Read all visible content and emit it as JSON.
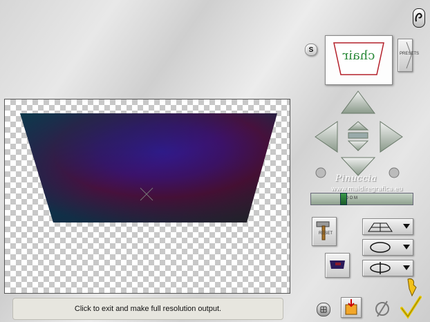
{
  "status_bar": {
    "text": "Click to exit and make full resolution output."
  },
  "toolbar": {
    "s_label": "S",
    "presets_label": "PRESETS",
    "reset_label": "RESET"
  },
  "preview_thumbnail": {
    "text": "chair"
  },
  "zoom_slider": {
    "label": "Z O O M",
    "value": 0.3
  },
  "watermark": {
    "line1": "Pinuccia",
    "line2": "www.maidiregrafica.eu"
  },
  "colors": {
    "accent": "#2b7a3a",
    "image_dark": "#0d3a4d",
    "image_purple": "#5a0f7a",
    "image_red": "#7a0d1c"
  },
  "icons": [
    "help-icon",
    "arrow-up-icon",
    "arrow-down-icon",
    "arrow-left-icon",
    "arrow-right-icon",
    "rotate-left-icon",
    "rotate-right-icon",
    "hammer-icon",
    "grid-icon",
    "rotate-icon",
    "flip-icon",
    "grid-toggle-icon",
    "save-output-icon",
    "cancel-icon",
    "accept-checkmark-icon",
    "hand-icon"
  ]
}
